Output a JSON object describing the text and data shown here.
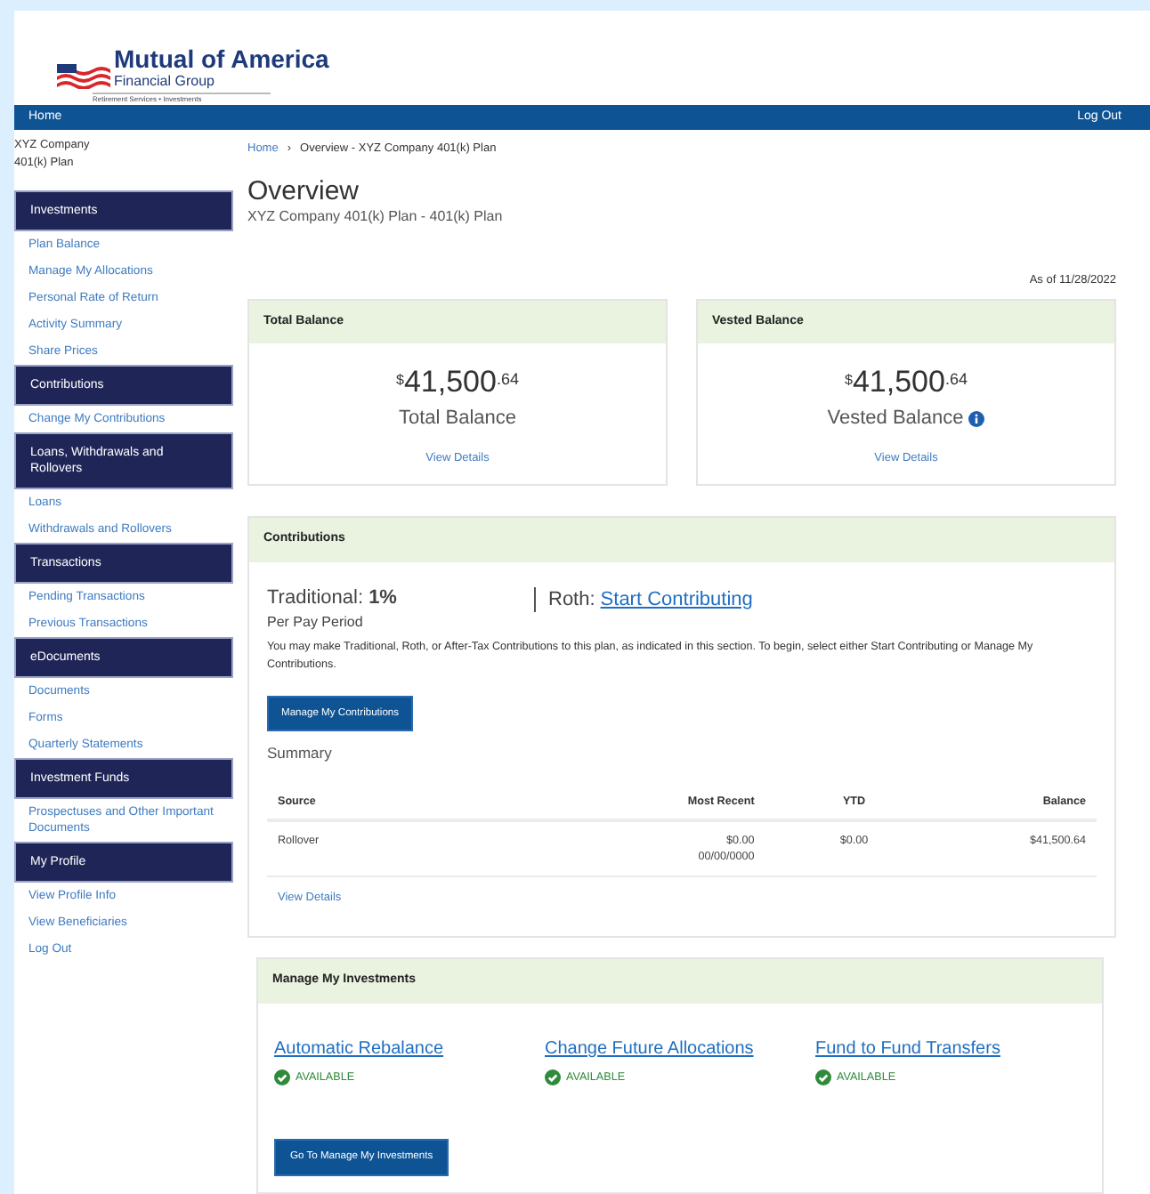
{
  "logo": {
    "name": "Mutual of America",
    "subtitle": "Financial Group",
    "tagline": "Retirement Services • Investments"
  },
  "nav": {
    "home": "Home",
    "logout": "Log Out"
  },
  "plan_name": "XYZ Company 401(k) Plan",
  "breadcrumb": [
    "Home",
    "›",
    "Overview - XYZ Company 401(k) Plan"
  ],
  "sidebar": [
    {
      "title": "Investments",
      "items": [
        "Plan Balance",
        "Manage My Allocations",
        "Personal Rate of Return",
        "Activity Summary",
        "Share Prices"
      ]
    },
    {
      "title": "Contributions",
      "items": [
        "Change My Contributions"
      ]
    },
    {
      "title": "Loans, Withdrawals and Rollovers",
      "items": [
        "Loans",
        "Withdrawals and Rollovers"
      ]
    },
    {
      "title": "Transactions",
      "items": [
        "Pending Transactions",
        "Previous Transactions"
      ]
    },
    {
      "title": "eDocuments",
      "items": [
        "Documents",
        "Forms",
        "Quarterly Statements"
      ]
    },
    {
      "title": "Investment Funds",
      "items": [
        "Prospectuses and Other Important Documents"
      ]
    },
    {
      "title": "My Profile",
      "items": [
        "View Profile Info",
        "View Beneficiaries",
        "Log Out"
      ]
    }
  ],
  "page": {
    "title": "Overview",
    "subtitle": "XYZ Company 401(k) Plan - 401(k) Plan",
    "as_of": "As of 11/28/2022"
  },
  "balances": [
    {
      "header": "Total Balance",
      "currency": "$",
      "amount": "41,500",
      "cents": ".64",
      "label": "Total Balance",
      "info": false,
      "link": "View Details"
    },
    {
      "header": "Vested Balance",
      "currency": "$",
      "amount": "41,500",
      "cents": ".64",
      "label": "Vested Balance",
      "info": true,
      "link": "View Details"
    }
  ],
  "contributions": {
    "header": "Contributions",
    "traditional": "Traditional: **1%**",
    "period": "Per Pay Period",
    "roth_label": "Roth:",
    "roth_link": "Start Contributing",
    "note": "You may make Traditional, Roth, or After-Tax Contributions to this plan, as indicated in this section. To begin, select either Start Contributing or Manage My Contributions.",
    "button": "Manage My Contributions",
    "summary_title": "Summary",
    "table": {
      "columns": [
        "Source",
        "Most Recent",
        "YTD",
        "Balance"
      ],
      "rows": [
        [
          [
            "Rollover"
          ],
          [
            "$0.00",
            "00/00/0000"
          ],
          [
            "$0.00"
          ],
          [
            "$41,500.64"
          ]
        ]
      ]
    },
    "link": "View Details"
  },
  "investments": {
    "header": "Manage My Investments",
    "items": [
      {
        "title": "Automatic Rebalance",
        "status": "AVAILABLE"
      },
      {
        "title": "Change Future Allocations",
        "status": "AVAILABLE"
      },
      {
        "title": "Fund to Fund Transfers",
        "status": "AVAILABLE"
      }
    ],
    "button": "Go To Manage My Investments"
  }
}
